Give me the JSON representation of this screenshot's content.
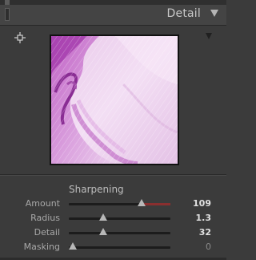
{
  "panel": {
    "title": "Detail",
    "collapse_icon": "triangle-down-icon"
  },
  "preview": {
    "target_icon": "crosshair-icon",
    "menu_icon": "triangle-down-icon"
  },
  "sharpening": {
    "title": "Sharpening",
    "sliders": [
      {
        "label": "Amount",
        "value": "109",
        "fraction": 0.73,
        "accent_fraction_end": 1.0,
        "dim": false
      },
      {
        "label": "Radius",
        "value": "1.3",
        "fraction": 0.33,
        "dim": false
      },
      {
        "label": "Detail",
        "value": "32",
        "fraction": 0.33,
        "dim": false
      },
      {
        "label": "Masking",
        "value": "0",
        "fraction": 0.0,
        "dim": true
      }
    ]
  },
  "colors": {
    "panel_bg": "#3b3b3b",
    "amount_accent": "#8a2f2f"
  }
}
